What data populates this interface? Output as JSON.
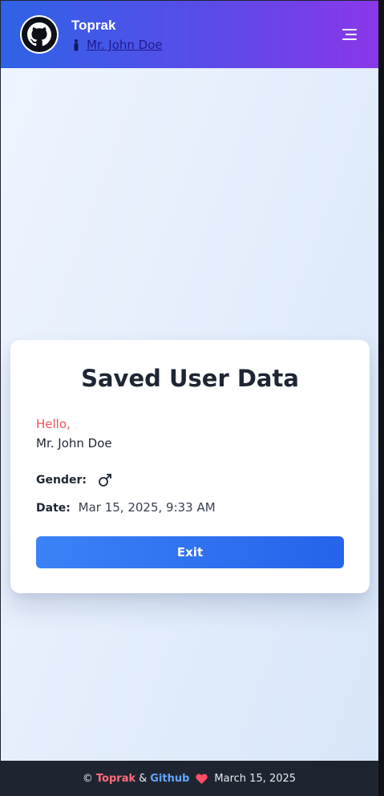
{
  "header": {
    "brand": "Toprak",
    "user_name": "Mr. John Doe",
    "menu_icon": "hamburger-icon",
    "avatar_icon": "github-icon"
  },
  "card": {
    "title": "Saved User Data",
    "greeting": "Hello,",
    "name": "Mr. John Doe",
    "gender_label": "Gender:",
    "gender_icon": "male-symbol-icon",
    "date_label": "Date:",
    "date_value": "Mar 15, 2025, 9:33 AM",
    "exit_label": "Exit"
  },
  "footer": {
    "copyright": "©",
    "author": "Toprak",
    "amp": "&",
    "link": "Github",
    "heart_icon": "heart-icon",
    "date": "March 15, 2025"
  },
  "colors": {
    "header_start": "#2e63e6",
    "header_end": "#8a37e8",
    "greeting": "#ef5459",
    "button": "#2563eb",
    "footer_bg": "#1f2530"
  }
}
